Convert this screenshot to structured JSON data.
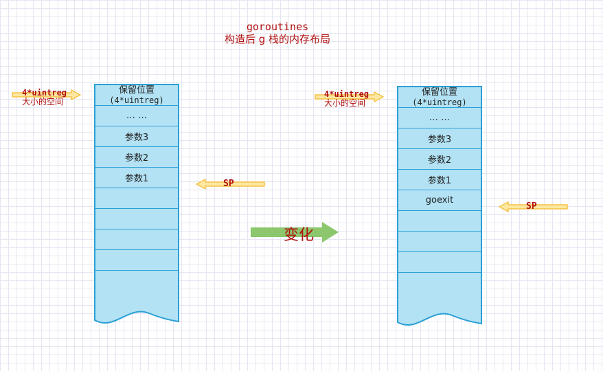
{
  "title": {
    "line1": "goroutines",
    "line2": "构造后 g 栈的内存布局"
  },
  "left_stack": {
    "top_cell": {
      "line1": "保留位置",
      "line2": "(4*uintreg)"
    },
    "cells": [
      "… …",
      "参数3",
      "参数2",
      "参数1",
      "",
      "",
      "",
      ""
    ]
  },
  "right_stack": {
    "top_cell": {
      "line1": "保留位置",
      "line2": "(4*uintreg)"
    },
    "cells": [
      "… …",
      "参数3",
      "参数2",
      "参数1",
      "goexit",
      "",
      "",
      ""
    ]
  },
  "annotations": {
    "left_reserve": {
      "line1": "4*uintreg",
      "line2": "大小的空间"
    },
    "right_reserve": {
      "line1": "4*uintreg",
      "line2": "大小的空间"
    },
    "left_sp": "SP",
    "right_sp": "SP",
    "change": "变化"
  },
  "colors": {
    "cell_fill": "#b2e2f4",
    "cell_border": "#2aa0d6",
    "label_red": "#b10e0e",
    "yellow_arrow": "#f5c242",
    "green_arrow": "#8cc76e"
  }
}
